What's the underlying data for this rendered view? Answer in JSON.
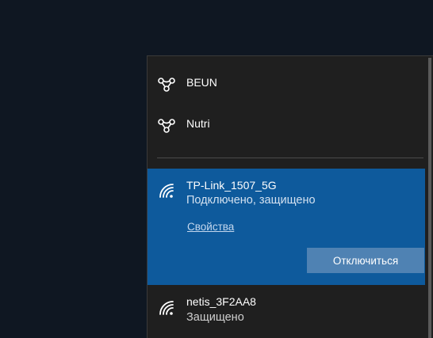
{
  "networks": [
    {
      "name": "BEUN",
      "type": "mobile-hotspot-icon"
    },
    {
      "name": "Nutri",
      "type": "mobile-hotspot-icon"
    }
  ],
  "connected": {
    "name": "TP-Link_1507_5G",
    "status": "Подключено, защищено",
    "properties_label": "Свойства",
    "disconnect_label": "Отключиться",
    "icon": "wifi-icon"
  },
  "other": {
    "name": "netis_3F2AA8",
    "status": "Защищено",
    "icon": "wifi-icon"
  },
  "colors": {
    "desktop": "#0f1722",
    "flyout": "#1f1f1f",
    "selected": "#0e5a9c",
    "button": "#4f82b3"
  }
}
